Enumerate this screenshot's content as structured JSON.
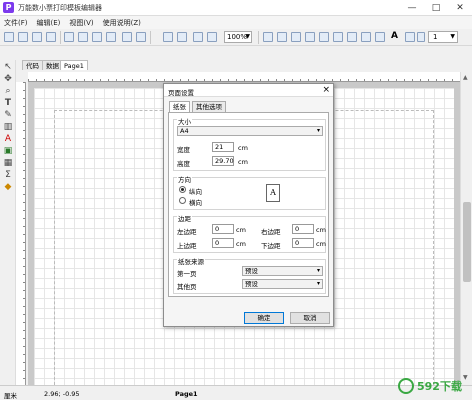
{
  "window": {
    "title": "万能数小票打印模板编辑器",
    "app_icon": "P",
    "buttons": [
      "—",
      "□",
      "✕"
    ]
  },
  "menu": [
    "文件(F)",
    "编辑(E)",
    "视图(V)",
    "使用说明(Z)"
  ],
  "toolbar": {
    "zoom": "100%",
    "font_size": "1"
  },
  "tabs": [
    "代码",
    "数据",
    "Page1"
  ],
  "dialog": {
    "title": "页面设置",
    "close": "×",
    "tabs": [
      "纸张",
      "其他选项"
    ],
    "size": {
      "label": "大小",
      "paper": "A4",
      "width_label": "宽度",
      "width": "21",
      "height_label": "高度",
      "height": "29.70",
      "unit": "cm"
    },
    "orientation": {
      "label": "方向",
      "portrait": "纵向",
      "landscape": "横向",
      "icon_letter": "A"
    },
    "margins": {
      "label": "边距",
      "left_label": "左边距",
      "left": "0",
      "right_label": "右边距",
      "right": "0",
      "top_label": "上边距",
      "top": "0",
      "bottom_label": "下边距",
      "bottom": "0",
      "unit": "cm"
    },
    "source": {
      "label": "纸张来源",
      "first_label": "第一页",
      "first": "预设",
      "other_label": "其他页",
      "other": "预设"
    },
    "ok": "确定",
    "cancel": "取消"
  },
  "status": {
    "unit": "厘米",
    "coord": "2.96; -0.95",
    "page": "Page1"
  },
  "watermark": {
    "text": "592下载"
  },
  "colors": {
    "accent": "#0078d7",
    "app": "#7c3aed",
    "watermark": "#3aa843"
  }
}
